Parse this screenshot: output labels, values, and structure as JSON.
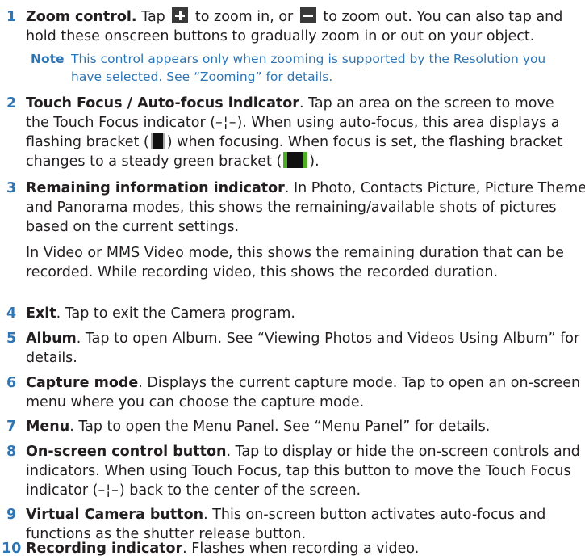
{
  "items": [
    {
      "num": "1",
      "title": "Zoom control.",
      "line1_a": " Tap ",
      "line1_b": " to zoom in, or ",
      "line1_c": " to zoom out. You can also tap and",
      "line2": "hold these onscreen buttons to gradually zoom in or out on your object.",
      "plus_icon": "zoom-in-plus-icon",
      "minus_icon": "zoom-out-minus-icon",
      "note_label": "Note",
      "note_line1": "This control appears only when zooming is supported by the Resolution you",
      "note_line2": "have selected. See “Zooming” for details."
    },
    {
      "num": "2",
      "title": "Touch Focus / Auto-focus indicator",
      "line1_rest": ". Tap an area on the screen to move",
      "line2_a": "the Touch Focus indicator (",
      "line2_sym": "–¦–",
      "line2_b": "). When using auto-focus, this area displays a",
      "line3_a": "flashing bracket (",
      "line3_b": ") when focusing. When focus is set, the flashing bracket",
      "line4_a": "changes to a steady green bracket (",
      "line4_b": ").",
      "accent_green": "#4caf24"
    },
    {
      "num": "3",
      "title": "Remaining information indicator",
      "line1_rest": ". In Photo, Contacts Picture, Picture Theme,",
      "line2": "and Panorama modes, this shows the remaining/available shots of pictures",
      "line3": "based on the current settings.",
      "para2_line1": "In Video or MMS Video mode, this shows the remaining duration that can be",
      "para2_line2": "recorded. While recording video, this shows the recorded duration."
    },
    {
      "num": "4",
      "title": "Exit",
      "line1_rest": ". Tap to exit the Camera program."
    },
    {
      "num": "5",
      "title": "Album",
      "line1_rest": ". Tap to open Album. See “Viewing Photos and Videos Using Album” for",
      "line2": "details."
    },
    {
      "num": "6",
      "title": "Capture mode",
      "line1_rest": ". Displays the current capture mode. Tap to open an on-screen",
      "line2": "menu where you can choose the capture mode."
    },
    {
      "num": "7",
      "title": "Menu",
      "line1_rest": ". Tap to open the Menu Panel. See “Menu Panel” for details."
    },
    {
      "num": "8",
      "title": "On-screen control button",
      "line1_rest": ". Tap to display or hide the on-screen controls and",
      "line2": "indicators. When using Touch Focus, tap this button to move the Touch Focus",
      "line3_a": "indicator (",
      "line3_sym": "–¦–",
      "line3_b": ") back to the center of the screen."
    },
    {
      "num": "9",
      "title": "Virtual Camera button",
      "line1_rest": ". This on-screen button activates auto-focus and",
      "line2": "functions as the shutter release button."
    },
    {
      "num": "10",
      "title": "Recording indicator",
      "line1_rest": ". Flashes when recording a video."
    }
  ],
  "colors": {
    "number": "#2e75b5",
    "note": "#2e75b5",
    "text": "#231f20"
  }
}
